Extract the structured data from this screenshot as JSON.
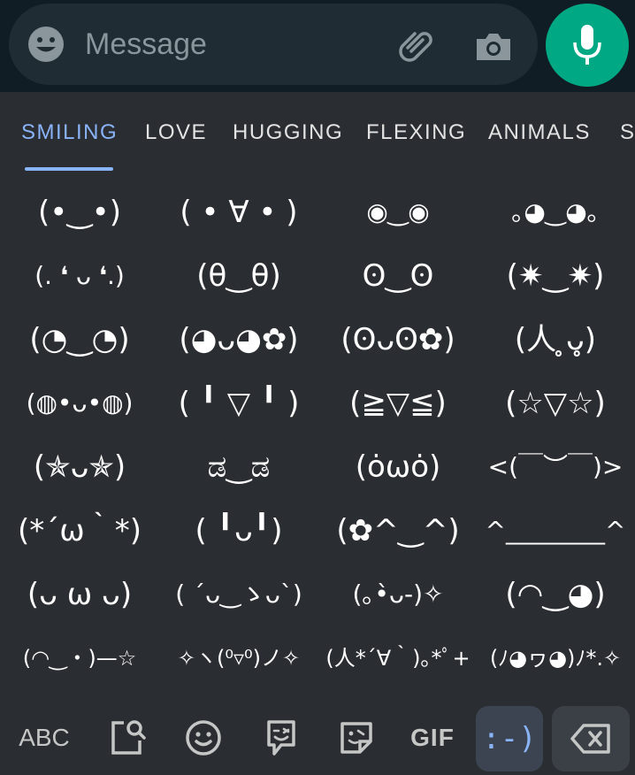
{
  "message_bar": {
    "placeholder": "Message",
    "icons": [
      "emoji-icon",
      "paperclip-icon",
      "camera-icon",
      "microphone-icon"
    ],
    "mic_color": "#00a884"
  },
  "tabs": [
    {
      "label": "SMILING",
      "active": true
    },
    {
      "label": "LOVE"
    },
    {
      "label": "HUGGING"
    },
    {
      "label": "FLEXING"
    },
    {
      "label": "ANIMALS"
    },
    {
      "label": "S"
    }
  ],
  "emoticons": [
    [
      "(•‿•)",
      "( • ∀ • )",
      "◉‿◉",
      "｡◕‿◕｡"
    ],
    [
      "(. ❛ ᴗ ❛.)",
      "(θ‿θ)",
      "ʘ‿ʘ",
      "(✷‿✷)"
    ],
    [
      "(◔‿◔)",
      "(◕ᴗ◕✿)",
      "(ʘᴗʘ✿)",
      "(人 ̥ᴗ̥)"
    ],
    [
      "(◍•ᴗ•◍)",
      "( ╹ ▽ ╹ )",
      "(≧▽≦)",
      "(☆▽☆)"
    ],
    [
      "(✯ᴗ✯)",
      "ಡ‿ಡ",
      "(ȯωȯ)",
      "<(￣︶￣)>"
    ],
    [
      "(*´ω｀*)",
      "( ╹ᴗ╹)",
      "(✿^‿^)",
      "^________^"
    ],
    [
      "(ᴗ ω ᴗ)",
      "( ´ᴗ‿ゝᴗ`)",
      "(｡•̀ᴗ-)✧",
      "(◠‿◕)"
    ],
    [
      "(◠‿・)—☆",
      "✧ヽ(⁰▿⁰)ノ✧",
      "(人*´∀｀)｡*ﾟ+",
      "(ﾉ◕ヮ◕)ﾉ*.✧"
    ]
  ],
  "bottom_bar": {
    "abc_label": "ABC",
    "gif_label": "GIF",
    "emoticon_label": ":-)",
    "accent": "#8ab4f8"
  }
}
